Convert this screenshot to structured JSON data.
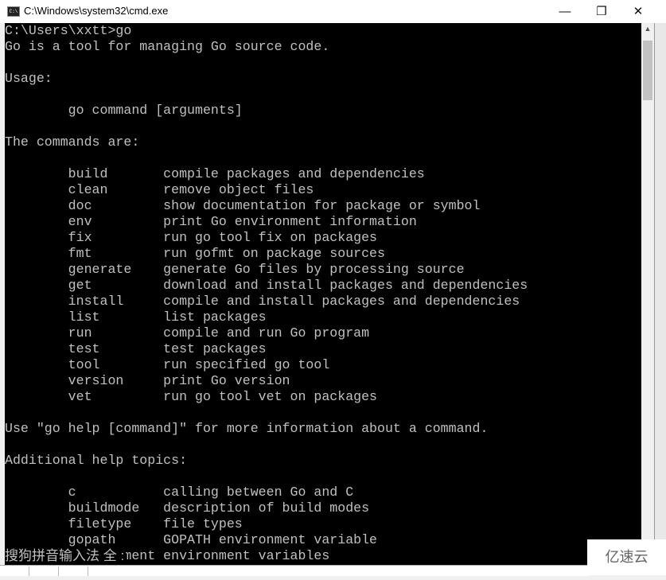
{
  "window": {
    "title": "C:\\Windows\\system32\\cmd.exe",
    "icon": "cmd-icon",
    "minimize": "—",
    "maximize": "❐",
    "close": "✕"
  },
  "terminal": {
    "lines": [
      "C:\\Users\\xxtt>go",
      "Go is a tool for managing Go source code.",
      "",
      "Usage:",
      "",
      "        go command [arguments]",
      "",
      "The commands are:",
      "",
      "        build       compile packages and dependencies",
      "        clean       remove object files",
      "        doc         show documentation for package or symbol",
      "        env         print Go environment information",
      "        fix         run go tool fix on packages",
      "        fmt         run gofmt on package sources",
      "        generate    generate Go files by processing source",
      "        get         download and install packages and dependencies",
      "        install     compile and install packages and dependencies",
      "        list        list packages",
      "        run         compile and run Go program",
      "        test        test packages",
      "        tool        run specified go tool",
      "        version     print Go version",
      "        vet         run go tool vet on packages",
      "",
      "Use \"go help [command]\" for more information about a command.",
      "",
      "Additional help topics:",
      "",
      "        c           calling between Go and C",
      "        buildmode   description of build modes",
      "        filetype    file types",
      "        gopath      GOPATH environment variable",
      "        environment environment variables"
    ]
  },
  "ime": {
    "label": "搜狗拼音输入法 全 :"
  },
  "watermark": "亿速云"
}
